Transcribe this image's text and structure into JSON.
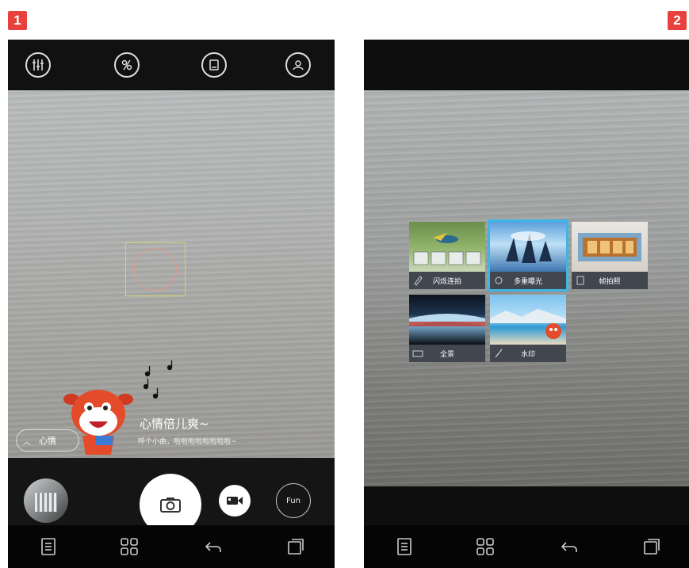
{
  "badges": {
    "left": "1",
    "right": "2"
  },
  "screen1": {
    "mood_button_label": "心情",
    "mood_title": "心情倍儿爽~",
    "mood_subtitle": "呼个小曲，啦啦啦啦啦啦啦啦~",
    "fun_label": "Fun"
  },
  "screen2": {
    "modes": [
      {
        "label": "闪烁连拍"
      },
      {
        "label": "多重曝光"
      },
      {
        "label": "帧拍照"
      },
      {
        "label": "全景"
      },
      {
        "label": "水印"
      }
    ]
  }
}
